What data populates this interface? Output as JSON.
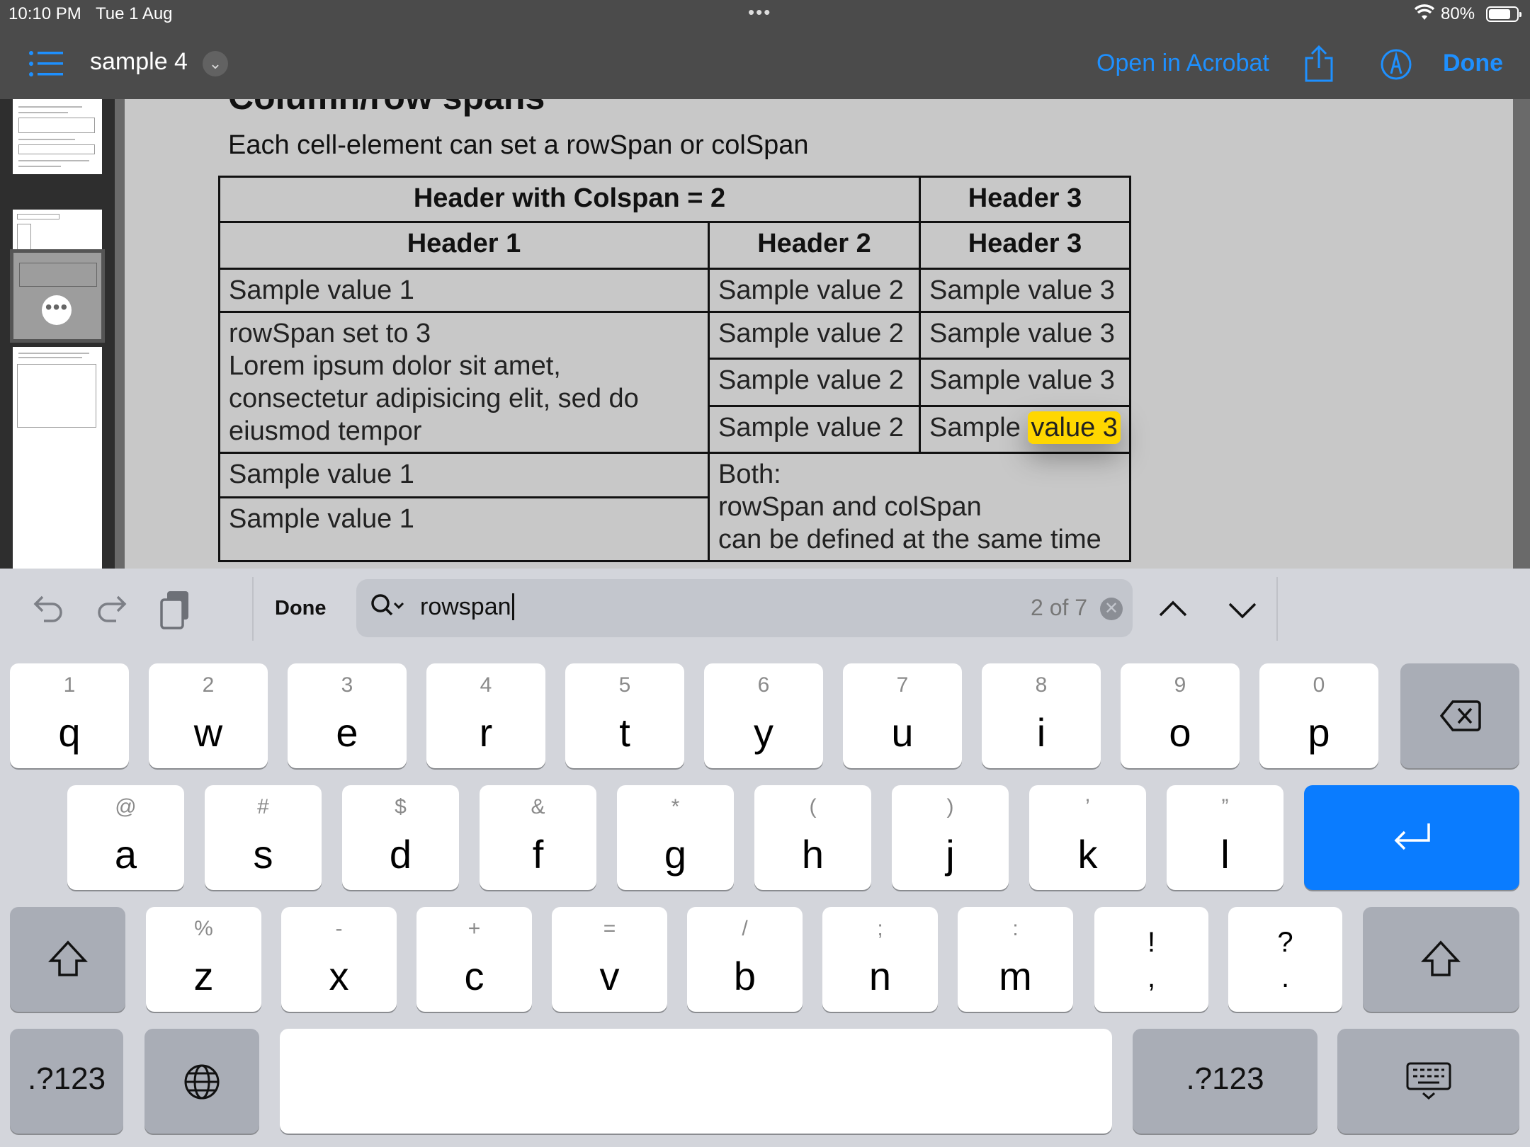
{
  "status": {
    "time": "10:10 PM",
    "date": "Tue 1 Aug",
    "dots": "•••",
    "battery": "80%"
  },
  "nav": {
    "title": "sample 4",
    "open_in": "Open in Acrobat",
    "done": "Done"
  },
  "thumbnails": {
    "more": "•••"
  },
  "document": {
    "heading": "Column/row spans",
    "intro": "Each cell-element can set a rowSpan or colSpan",
    "table": {
      "h_colspan": "Header with Colspan = 2",
      "h3a": "Header 3",
      "h1": "Header 1",
      "h2": "Header 2",
      "h3b": "Header 3",
      "r1c1": "Sample value 1",
      "r1c2": "Sample value 2",
      "r1c3": "Sample value 3",
      "rowspan_l1": "rowSpan set to 3",
      "rowspan_l2": "Lorem ipsum dolor sit amet,",
      "rowspan_l3": "consectetur adipisicing elit, sed do",
      "rowspan_l4": "eiusmod tempor",
      "r2c2": "Sample value 2",
      "r2c3": "Sample value 3",
      "r3c2": "Sample value 2",
      "r3c3": "Sample value 3",
      "r4c2": "Sample value 2",
      "r4c3_pre": "Sample",
      "r4c3_match": "value 3",
      "r5c1": "Sample value 1",
      "both_l1": "Both:",
      "both_l2": "rowSpan and colSpan",
      "both_l3": "can be defined at the same time",
      "r6c1": "Sample value 1"
    }
  },
  "find": {
    "done": "Done",
    "query": "rowspan",
    "count": "2 of 7",
    "clear": "✕"
  },
  "keyboard": {
    "row1": [
      {
        "k": "q",
        "a": "1"
      },
      {
        "k": "w",
        "a": "2"
      },
      {
        "k": "e",
        "a": "3"
      },
      {
        "k": "r",
        "a": "4"
      },
      {
        "k": "t",
        "a": "5"
      },
      {
        "k": "y",
        "a": "6"
      },
      {
        "k": "u",
        "a": "7"
      },
      {
        "k": "i",
        "a": "8"
      },
      {
        "k": "o",
        "a": "9"
      },
      {
        "k": "p",
        "a": "0"
      }
    ],
    "row2": [
      {
        "k": "a",
        "a": "@"
      },
      {
        "k": "s",
        "a": "#"
      },
      {
        "k": "d",
        "a": "$"
      },
      {
        "k": "f",
        "a": "&"
      },
      {
        "k": "g",
        "a": "*"
      },
      {
        "k": "h",
        "a": "("
      },
      {
        "k": "j",
        "a": ")"
      },
      {
        "k": "k",
        "a": "’"
      },
      {
        "k": "l",
        "a": "”"
      }
    ],
    "row3": [
      {
        "k": "z",
        "a": "%"
      },
      {
        "k": "x",
        "a": "-"
      },
      {
        "k": "c",
        "a": "+"
      },
      {
        "k": "v",
        "a": "="
      },
      {
        "k": "b",
        "a": "/"
      },
      {
        "k": "n",
        "a": ";"
      },
      {
        "k": "m",
        "a": ":"
      }
    ],
    "punct1": {
      "top": "!",
      "bottom": ","
    },
    "punct2": {
      "top": "?",
      "bottom": "."
    },
    "numbers_left": ".?123",
    "numbers_right": ".?123",
    "colors": {
      "accent": "#0a7cff",
      "highlight": "#ffd700"
    }
  }
}
